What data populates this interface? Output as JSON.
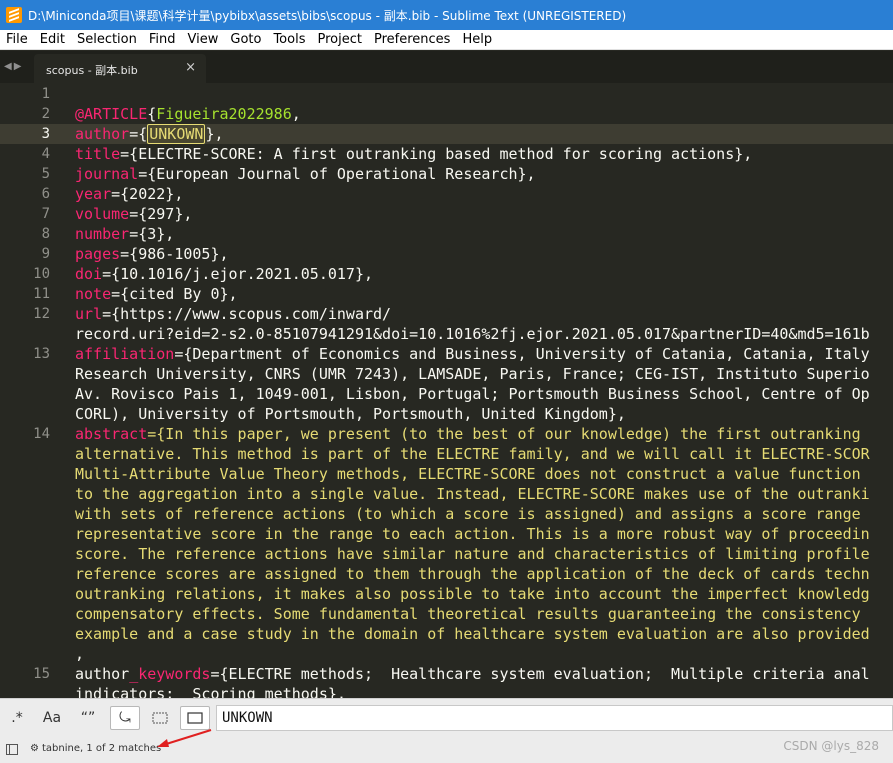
{
  "window": {
    "title": "D:\\Miniconda项目\\课题\\科学计量\\pybibx\\assets\\bibs\\scopus - 副本.bib - Sublime Text (UNREGISTERED)"
  },
  "menu": [
    "File",
    "Edit",
    "Selection",
    "Find",
    "View",
    "Goto",
    "Tools",
    "Project",
    "Preferences",
    "Help"
  ],
  "tab": {
    "label": "scopus - 副本.bib",
    "close": "×"
  },
  "editor": {
    "current_line": 3,
    "lines": [
      {
        "num": "1",
        "segments": []
      },
      {
        "num": "2",
        "segments": [
          {
            "t": "@ARTICLE",
            "c": "k"
          },
          {
            "t": "{",
            "c": "p"
          },
          {
            "t": "Figueira2022986",
            "c": "n"
          },
          {
            "t": ",",
            "c": "p"
          }
        ]
      },
      {
        "num": "3",
        "segments": [
          {
            "t": "author",
            "c": "k"
          },
          {
            "t": "={",
            "c": "p"
          },
          {
            "t": "UNKOWN",
            "c": "match"
          },
          {
            "t": "},",
            "c": "p"
          }
        ]
      },
      {
        "num": "4",
        "segments": [
          {
            "t": "title",
            "c": "k"
          },
          {
            "t": "={ELECTRE-SCORE: A first outranking based method for scoring actions},",
            "c": "p"
          }
        ]
      },
      {
        "num": "5",
        "segments": [
          {
            "t": "journal",
            "c": "k"
          },
          {
            "t": "={European Journal of Operational Research},",
            "c": "p"
          }
        ]
      },
      {
        "num": "6",
        "segments": [
          {
            "t": "year",
            "c": "k"
          },
          {
            "t": "={2022},",
            "c": "p"
          }
        ]
      },
      {
        "num": "7",
        "segments": [
          {
            "t": "volume",
            "c": "k"
          },
          {
            "t": "={297},",
            "c": "p"
          }
        ]
      },
      {
        "num": "8",
        "segments": [
          {
            "t": "number",
            "c": "k"
          },
          {
            "t": "={3},",
            "c": "p"
          }
        ]
      },
      {
        "num": "9",
        "segments": [
          {
            "t": "pages",
            "c": "k"
          },
          {
            "t": "={986-1005},",
            "c": "p"
          }
        ]
      },
      {
        "num": "10",
        "segments": [
          {
            "t": "doi",
            "c": "k"
          },
          {
            "t": "={10.1016/j.ejor.2021.05.017},",
            "c": "p"
          }
        ]
      },
      {
        "num": "11",
        "segments": [
          {
            "t": "note",
            "c": "k"
          },
          {
            "t": "={cited By 0},",
            "c": "p"
          }
        ]
      },
      {
        "num": "12",
        "segments": [
          {
            "t": "url",
            "c": "k"
          },
          {
            "t": "={https://www.scopus.com/inward/",
            "c": "p"
          }
        ]
      },
      {
        "num": "",
        "segments": [
          {
            "t": "record.uri?eid=2-s2.0-85107941291&doi=10.1016%2fj.ejor.2021.05.017&partnerID=40&md5=161b",
            "c": "p"
          }
        ]
      },
      {
        "num": "13",
        "segments": [
          {
            "t": "affiliation",
            "c": "k"
          },
          {
            "t": "={Department of Economics and Business, University of Catania, Catania, Italy",
            "c": "p"
          }
        ]
      },
      {
        "num": "",
        "segments": [
          {
            "t": "Research University, CNRS (UMR 7243), LAMSADE, Paris, France; CEG-IST, Instituto Superio",
            "c": "p"
          }
        ]
      },
      {
        "num": "",
        "segments": [
          {
            "t": "Av. Rovisco Pais 1, 1049-001, Lisbon, Portugal; Portsmouth Business School, Centre of Op",
            "c": "p"
          }
        ]
      },
      {
        "num": "",
        "segments": [
          {
            "t": "CORL), University of Portsmouth, Portsmouth, United Kingdom},",
            "c": "p"
          }
        ]
      },
      {
        "num": "14",
        "segments": [
          {
            "t": "abstract",
            "c": "k"
          },
          {
            "t": "={In this paper, we present (to the best of our knowledge) the first outranking",
            "c": "v"
          }
        ]
      },
      {
        "num": "",
        "segments": [
          {
            "t": "alternative. This method is part of the ELECTRE family, and we will call it ELECTRE-SCOR",
            "c": "v"
          }
        ]
      },
      {
        "num": "",
        "segments": [
          {
            "t": "Multi-Attribute Value Theory methods, ELECTRE-SCORE does not construct a value function",
            "c": "v"
          }
        ]
      },
      {
        "num": "",
        "segments": [
          {
            "t": "to the aggregation into a single value. Instead, ELECTRE-SCORE makes use of the outranki",
            "c": "v"
          }
        ]
      },
      {
        "num": "",
        "segments": [
          {
            "t": "with sets of reference actions (to which a score is assigned) and assigns a score range",
            "c": "v"
          }
        ]
      },
      {
        "num": "",
        "segments": [
          {
            "t": "representative score in the range to each action. This is a more robust way of proceedin",
            "c": "v"
          }
        ]
      },
      {
        "num": "",
        "segments": [
          {
            "t": "score. The reference actions have similar nature and characteristics of limiting profile",
            "c": "v"
          }
        ]
      },
      {
        "num": "",
        "segments": [
          {
            "t": "reference scores are assigned to them through the application of the deck of cards techn",
            "c": "v"
          }
        ]
      },
      {
        "num": "",
        "segments": [
          {
            "t": "outranking relations, it makes also possible to take into account the imperfect knowledg",
            "c": "v"
          }
        ]
      },
      {
        "num": "",
        "segments": [
          {
            "t": "compensatory effects. Some fundamental theoretical results guaranteeing the consistency",
            "c": "v"
          }
        ]
      },
      {
        "num": "",
        "segments": [
          {
            "t": "example and a case study in the domain of healthcare system evaluation are also provided",
            "c": "v"
          }
        ]
      },
      {
        "num": "",
        "segments": [
          {
            "t": ",",
            "c": "p"
          }
        ]
      },
      {
        "num": "15",
        "segments": [
          {
            "t": "author",
            "c": "p"
          },
          {
            "t": "_keywords",
            "c": "k"
          },
          {
            "t": "={ELECTRE methods;  Healthcare system evaluation;  Multiple criteria anal",
            "c": "p"
          }
        ]
      },
      {
        "num": "",
        "segments": [
          {
            "t": "indicators;  Scoring methods},",
            "c": "p"
          }
        ]
      }
    ]
  },
  "find_panel": {
    "buttons": [
      {
        "id": "regex",
        "label": ".*",
        "active": false
      },
      {
        "id": "case",
        "label": "Aa",
        "active": false
      },
      {
        "id": "whole_word",
        "label": "“”",
        "active": false
      },
      {
        "id": "wrap",
        "label": "⤿",
        "active": true
      },
      {
        "id": "in_selection",
        "label": "",
        "active": false
      },
      {
        "id": "highlight",
        "label": "",
        "active": true
      }
    ],
    "query": "UNKOWN"
  },
  "status": {
    "text": "tabnine, 1 of 2 matches",
    "watermark": "CSDN @lys_828"
  },
  "colors": {
    "titlebar": "#2a7fd4",
    "editor_bg": "#272822",
    "keyword": "#f92672",
    "string": "#e6db74",
    "name": "#a6e22e",
    "annotation_arrow": "#e02020"
  }
}
